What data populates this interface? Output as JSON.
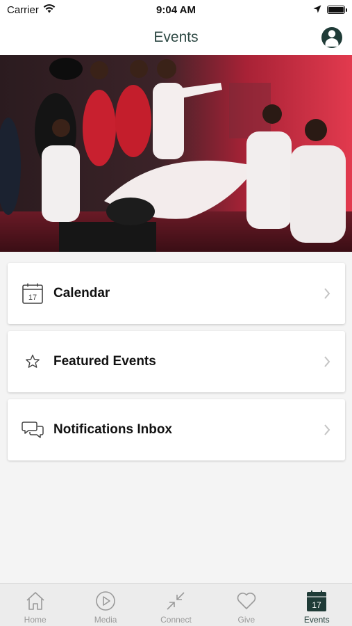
{
  "status_bar": {
    "carrier": "Carrier",
    "time": "9:04 AM"
  },
  "header": {
    "title": "Events"
  },
  "menu": {
    "items": [
      {
        "label": "Calendar",
        "icon": "calendar-icon",
        "calendar_day": "17"
      },
      {
        "label": "Featured Events",
        "icon": "star-icon"
      },
      {
        "label": "Notifications Inbox",
        "icon": "chat-bubbles-icon"
      }
    ]
  },
  "tabbar": {
    "tabs": [
      {
        "label": "Home",
        "icon": "home-icon",
        "active": false
      },
      {
        "label": "Media",
        "icon": "play-icon",
        "active": false
      },
      {
        "label": "Connect",
        "icon": "arrows-in-icon",
        "active": false
      },
      {
        "label": "Give",
        "icon": "heart-icon",
        "active": false
      },
      {
        "label": "Events",
        "icon": "calendar-icon",
        "active": true,
        "calendar_day": "17"
      }
    ]
  },
  "colors": {
    "brand": "#1f3b37",
    "header_title": "#2f4a45",
    "background": "#f4f4f4",
    "inactive_tab": "#9a9a9a"
  }
}
